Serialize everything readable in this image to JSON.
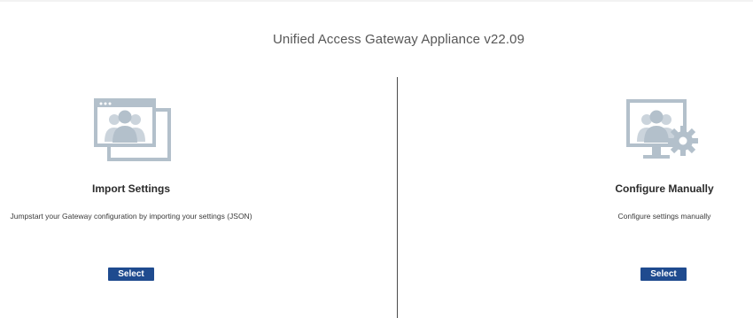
{
  "header": {
    "title": "Unified Access Gateway Appliance v22.09"
  },
  "options": [
    {
      "icon": "import-settings-icon",
      "title": "Import Settings",
      "description": "Jumpstart your Gateway configuration by importing your settings (JSON)",
      "button_label": "Select"
    },
    {
      "icon": "configure-manually-icon",
      "title": "Configure Manually",
      "description": "Configure settings manually",
      "button_label": "Select"
    }
  ],
  "colors": {
    "button": "#1f4b8f",
    "icon": "#b3c0cb",
    "divider": "#4a4a4a"
  }
}
